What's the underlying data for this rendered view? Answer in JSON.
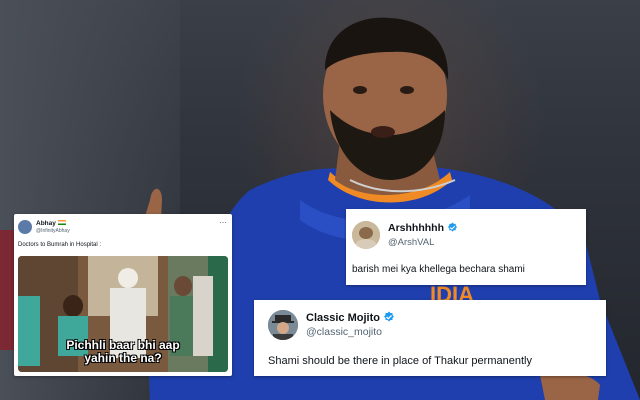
{
  "photo": {
    "jersey_text": "IDIA",
    "jersey_color": "#1f3fae",
    "accent_color": "#f08a24"
  },
  "tweets": [
    {
      "name": "Abhay",
      "flag_icon": "india-flag-icon",
      "handle": "@InfinityAbhay",
      "more_icon": "more-icon",
      "text": "Doctors to Bumrah in Hospital :",
      "meme_caption_line1": "Pichhli baar bhi aap",
      "meme_caption_line2": "yahin the na?"
    },
    {
      "name": "Arshhhhhh",
      "handle": "@ArshVAL",
      "verified_icon": "verified-badge-icon",
      "text": "barish mei kya khellega bechara shami"
    },
    {
      "name": "Classic Mojito",
      "handle": "@classic_mojito",
      "verified_icon": "verified-badge-icon",
      "text": "Shami should be there in place of Thakur permanently"
    }
  ],
  "colors": {
    "verified_blue": "#1d9bf0",
    "text_dark": "#0f1419",
    "text_muted": "#536471"
  }
}
